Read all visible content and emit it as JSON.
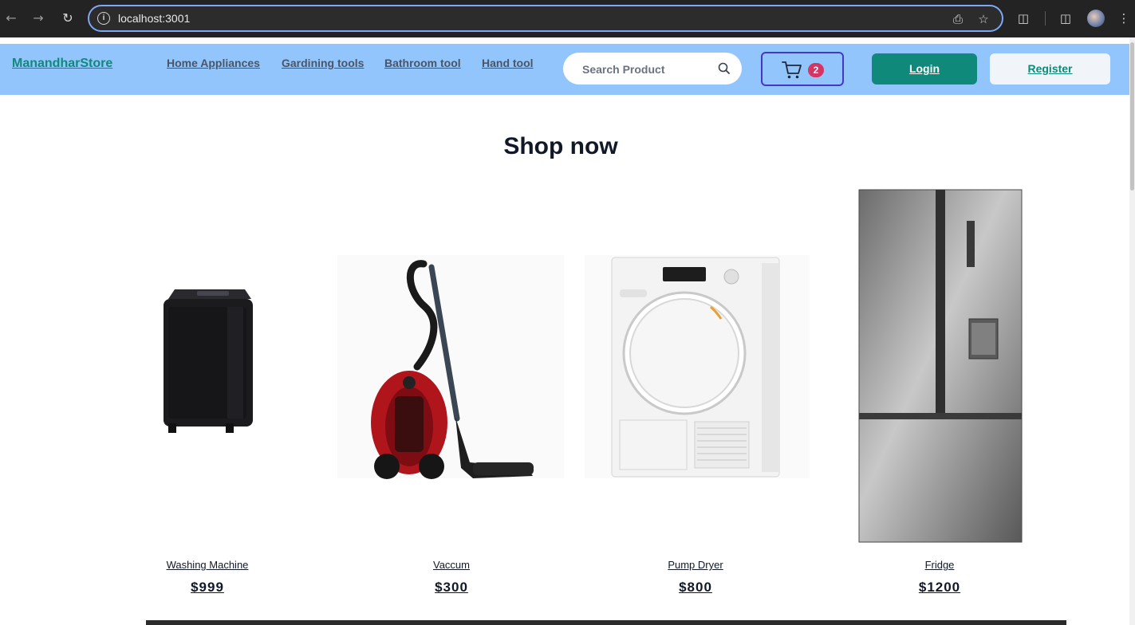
{
  "browser": {
    "url": "localhost:3001",
    "back_icon": "arrow-left-icon",
    "forward_icon": "arrow-right-icon",
    "reload_icon": "reload-icon"
  },
  "navbar": {
    "brand": "ManandharStore",
    "links": [
      "Home Appliances",
      "Gardining tools",
      "Bathroom tool",
      "Hand tool"
    ],
    "search_placeholder": "Search Product",
    "cart_count": "2",
    "login_label": "Login",
    "register_label": "Register",
    "colors": {
      "bar": "#93c5fd",
      "brand": "#0f8a7a",
      "cart_border": "#4338ca"
    }
  },
  "main": {
    "heading": "Shop now",
    "products": [
      {
        "name": "Washing Machine",
        "price": "$999"
      },
      {
        "name": "Vaccum",
        "price": "$300"
      },
      {
        "name": "Pump Dryer",
        "price": "$800"
      },
      {
        "name": "Fridge",
        "price": "$1200"
      }
    ]
  }
}
